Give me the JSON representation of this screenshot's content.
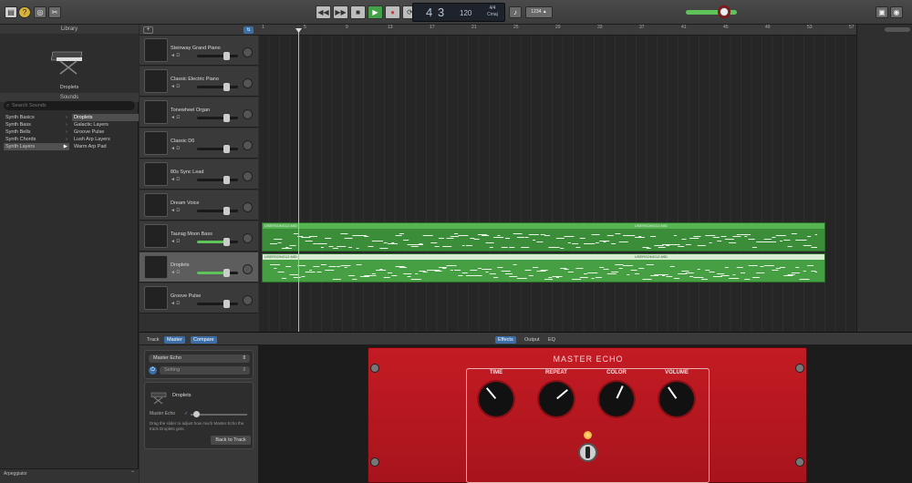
{
  "toolbar": {
    "lcd_position": "4 3",
    "lcd_tempo": "120",
    "lcd_time_signature": "4/4",
    "lcd_key": "Cmaj",
    "count_in": "1234"
  },
  "library": {
    "header": "Library",
    "selected_patch": "Droplets",
    "sounds_header": "Sounds",
    "search_placeholder": "Search Sounds",
    "categories": [
      {
        "label": "Synth Basics",
        "selected": false
      },
      {
        "label": "Synth Bass",
        "selected": false
      },
      {
        "label": "Synth Bells",
        "selected": false
      },
      {
        "label": "Synth Chords",
        "selected": false
      },
      {
        "label": "Synth Layers",
        "selected": true
      }
    ],
    "sounds": [
      {
        "label": "Droplets",
        "selected": true
      },
      {
        "label": "Galactic Layers",
        "selected": false
      },
      {
        "label": "Groove Pulse",
        "selected": false
      },
      {
        "label": "Lush Arp Layers",
        "selected": false
      },
      {
        "label": "Warm Arp Pad",
        "selected": false
      }
    ],
    "footer_label": "Arpeggiator"
  },
  "tracks": [
    {
      "name": "Steinway Grand Piano",
      "volume": 0.72,
      "selected": false
    },
    {
      "name": "Classic Electric Piano",
      "volume": 0.72,
      "selected": false
    },
    {
      "name": "Tonewheel Organ",
      "volume": 0.72,
      "selected": false
    },
    {
      "name": "Classic D6",
      "volume": 0.72,
      "selected": false
    },
    {
      "name": "80s Sync Lead",
      "volume": 0.72,
      "selected": false
    },
    {
      "name": "Dream Voice",
      "volume": 0.72,
      "selected": false
    },
    {
      "name": "Taurag Moon Bass",
      "volume": 0.72,
      "selected": false,
      "green": true
    },
    {
      "name": "Droplets",
      "volume": 0.72,
      "selected": true,
      "green": true
    },
    {
      "name": "Groove Pulse",
      "volume": 0.72,
      "selected": false
    }
  ],
  "ruler": {
    "bars": [
      "1",
      "5",
      "9",
      "13",
      "17",
      "21",
      "25",
      "29",
      "33",
      "37",
      "41",
      "45",
      "49",
      "53",
      "57"
    ]
  },
  "regions": [
    {
      "label_a": "USERSONG12.MID",
      "label_b": "USERSONG12.MID",
      "selected": false
    },
    {
      "label_a": "USERSONG12.MID",
      "label_b": "USERSONG12.MID",
      "selected": true
    }
  ],
  "editor": {
    "tabs_left": [
      "Track",
      "Master",
      "Compare"
    ],
    "tabs_center": [
      "Effects",
      "Output",
      "EQ"
    ],
    "effect_name": "Master Echo",
    "setting_label": "Setting",
    "track_name": "Droplets",
    "send_label": "Master Echo",
    "help_text": "Drag the slider to adjust how much Master Echo the track Droplets gets.",
    "back_button": "Back to Track"
  },
  "plugin": {
    "title": "MASTER ECHO",
    "knobs": [
      {
        "label": "TIME"
      },
      {
        "label": "REPEAT"
      },
      {
        "label": "COLOR"
      },
      {
        "label": "VOLUME"
      }
    ]
  },
  "colors": {
    "accent_blue": "#3c6ea8",
    "region_green": "#46a043",
    "plugin_red": "#c41b24"
  }
}
